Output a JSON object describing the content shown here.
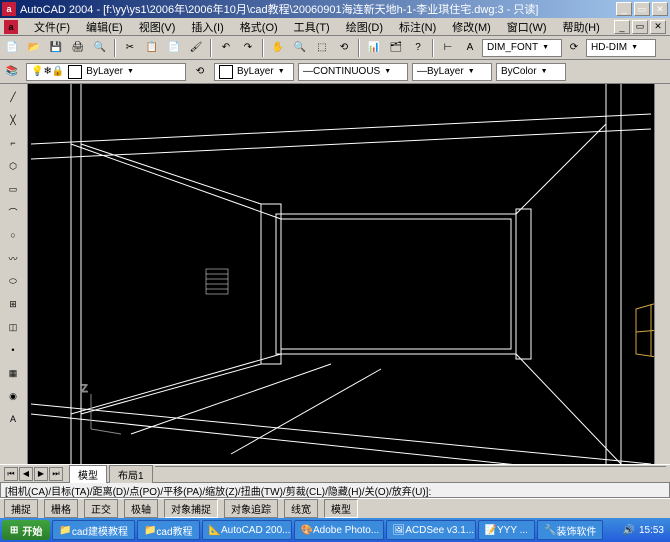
{
  "title": {
    "app": "AutoCAD 2004",
    "file": "[f:\\yy\\ys1\\2006年\\2006年10月\\cad教程\\20060901海连新天地h-1-李业琪住宅.dwg:3 - 只读]",
    "icon": "a"
  },
  "menu": {
    "items": [
      "文件(F)",
      "编辑(E)",
      "视图(V)",
      "插入(I)",
      "格式(O)",
      "工具(T)",
      "绘图(D)",
      "标注(N)",
      "修改(M)",
      "窗口(W)",
      "帮助(H)"
    ]
  },
  "toolbar1": {
    "dimstyle": "DIM_FONT",
    "dimtype": "HD-DIM"
  },
  "props": {
    "layer": "ByLayer",
    "linetype": "CONTINUOUS",
    "lineweight": "ByLayer",
    "color": "ByColor"
  },
  "ucs_label": "Z",
  "tabs": {
    "items": [
      "模型",
      "布局1"
    ],
    "active": 0
  },
  "cmdline": "[相机(CA)/目标(TA)/距离(D)/点(PO)/平移(PA)/缩放(Z)/扭曲(TW)/剪裁(CL)/隐藏(H)/关(O)/放弃(U)]:",
  "status": {
    "items": [
      "捕捉",
      "栅格",
      "正交",
      "极轴",
      "对象捕捉",
      "对象追踪",
      "线宽",
      "模型"
    ]
  },
  "taskbar": {
    "start": "开始",
    "items": [
      "cad建模教程",
      "cad教程",
      "AutoCAD 200...",
      "Adobe Photo...",
      "ACDSee v3.1...",
      "YYY ...",
      "装饰软件"
    ],
    "time": "15:53"
  }
}
